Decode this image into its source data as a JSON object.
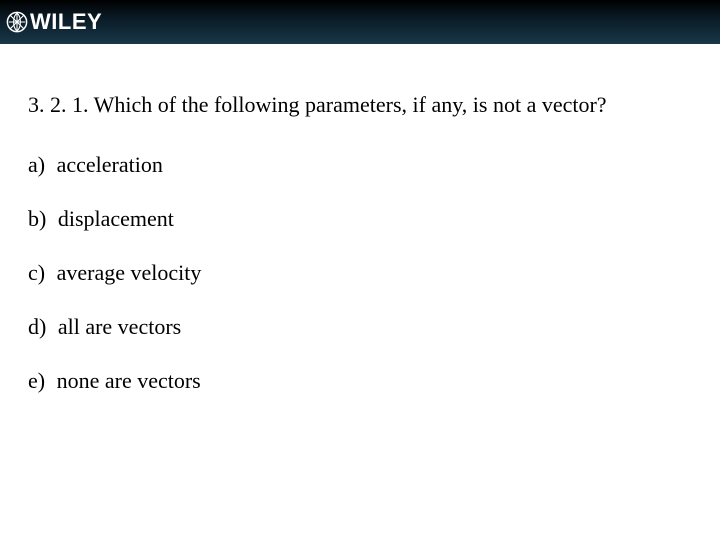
{
  "header": {
    "brand": "WILEY"
  },
  "question": {
    "number": "3. 2. 1.",
    "text": "Which of the following parameters, if any, is not a vector?"
  },
  "options": [
    {
      "label": "a)",
      "text": "acceleration"
    },
    {
      "label": "b)",
      "text": "displacement"
    },
    {
      "label": "c)",
      "text": "average velocity"
    },
    {
      "label": "d)",
      "text": "all are vectors"
    },
    {
      "label": "e)",
      "text": "none are vectors"
    }
  ]
}
